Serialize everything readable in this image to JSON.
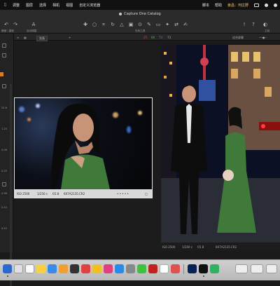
{
  "menubar": {
    "items": [
      "调整",
      "图层",
      "选择",
      "相机",
      "视图",
      "自定义浏览器"
    ],
    "right_items": [
      "脚本",
      "帮助"
    ],
    "user": "姜昌：何庄野"
  },
  "window": {
    "title": "Capture One Catalog"
  },
  "toolbar": {
    "left_labels": [
      "撤销 / 重做",
      "自动调整"
    ],
    "cursor_tools_label": "光标工具",
    "right_label": "之前"
  },
  "viewerbar": {
    "filter_value": "准备",
    "rgb": {
      "r": "25",
      "g": "66",
      "b": "73",
      "extra": "73"
    },
    "fit_label": "适合屏幕"
  },
  "leftpanel": {
    "values": [
      "52.6",
      "1.25",
      "0.06",
      "0.25",
      "0.96",
      "0.43",
      "0.53"
    ]
  },
  "thumbnail": {
    "iso": "ISO 2500",
    "shutter": "1/250 s",
    "aperture": "f/2.8",
    "filename": "6X7A2135.CR2",
    "dots": "• • • • •"
  },
  "preview": {
    "iso": "ISO 2500",
    "shutter": "1/200 s",
    "aperture": "f/2.8",
    "filename": "6X7A2135.CR2"
  },
  "colors": {
    "accent": "#e07a1f",
    "dress_green": "#3f7a3a",
    "selection_border": "#e6e6e6"
  },
  "dock": {
    "apps": [
      "finder-icon",
      "launchpad-icon",
      "reminders-icon",
      "notes-icon",
      "mail-icon",
      "pages-icon",
      "xcode-icon",
      "weibo-icon",
      "qq-music-icon",
      "app-store-icon",
      "settings-icon",
      "wechat-icon",
      "netease-music-icon",
      "chrome-icon",
      "photoshop-icon",
      "capture-one-icon",
      "terminal-icon",
      "keyboard-icon"
    ]
  }
}
